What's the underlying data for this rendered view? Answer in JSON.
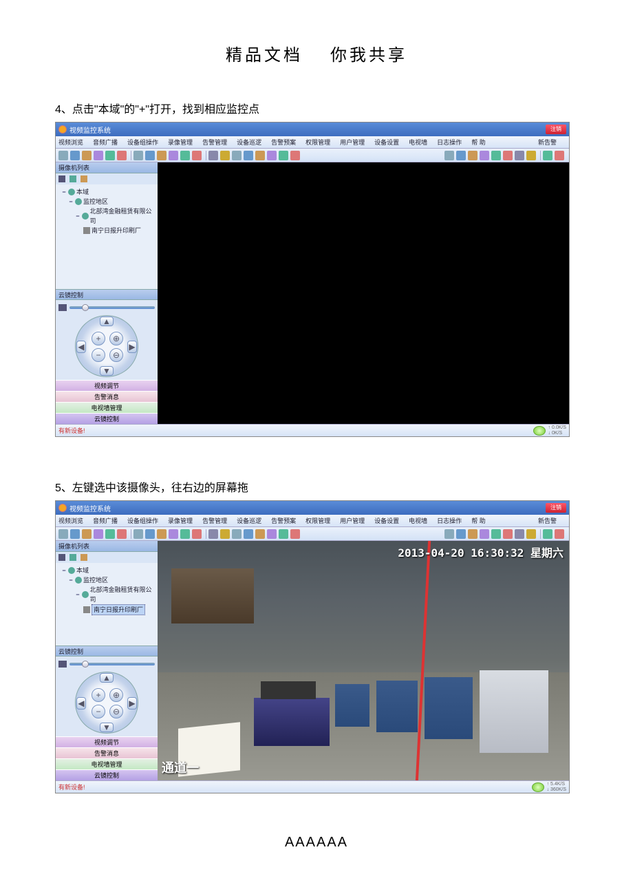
{
  "doc": {
    "header_left": "精品文档",
    "header_right": "你我共享",
    "footer": "AAAAAA"
  },
  "step4": {
    "text": "4、点击\"本域\"的\"+\"打开，找到相应监控点"
  },
  "step5": {
    "text": "5、左键选中该摄像头，往右边的屏幕拖"
  },
  "app": {
    "title": "视频监控系统",
    "close_btn": "注销",
    "menus": [
      "视频浏览",
      "音频广播",
      "设备组操作",
      "录像管理",
      "告警管理",
      "设备巡逻",
      "告警预案",
      "权限管理",
      "用户管理",
      "设备设置",
      "电视墙",
      "日志操作",
      "帮 助"
    ],
    "new_alarm": "新告警",
    "sidebar": {
      "tree_head": "摄像机列表",
      "ptz_head": "云镜控制",
      "nodes": {
        "root": "本域",
        "region": "监控地区",
        "company": "北部湾金融租赁有限公司",
        "camera": "南宁日报升印刷厂"
      },
      "tabs": [
        "视频调节",
        "告警消息",
        "电视墙管理",
        "云镜控制"
      ]
    },
    "status_text": "有新设备!",
    "bandwidth": {
      "up": "↑ 0.0K/S",
      "down": "↓ 0K/S"
    },
    "bandwidth2": {
      "up": "↑ 5.4K/S",
      "down": "↓ 360K/S"
    }
  },
  "feed": {
    "timestamp": "2013-04-20 16:30:32 星期六",
    "channel": "通道一"
  }
}
